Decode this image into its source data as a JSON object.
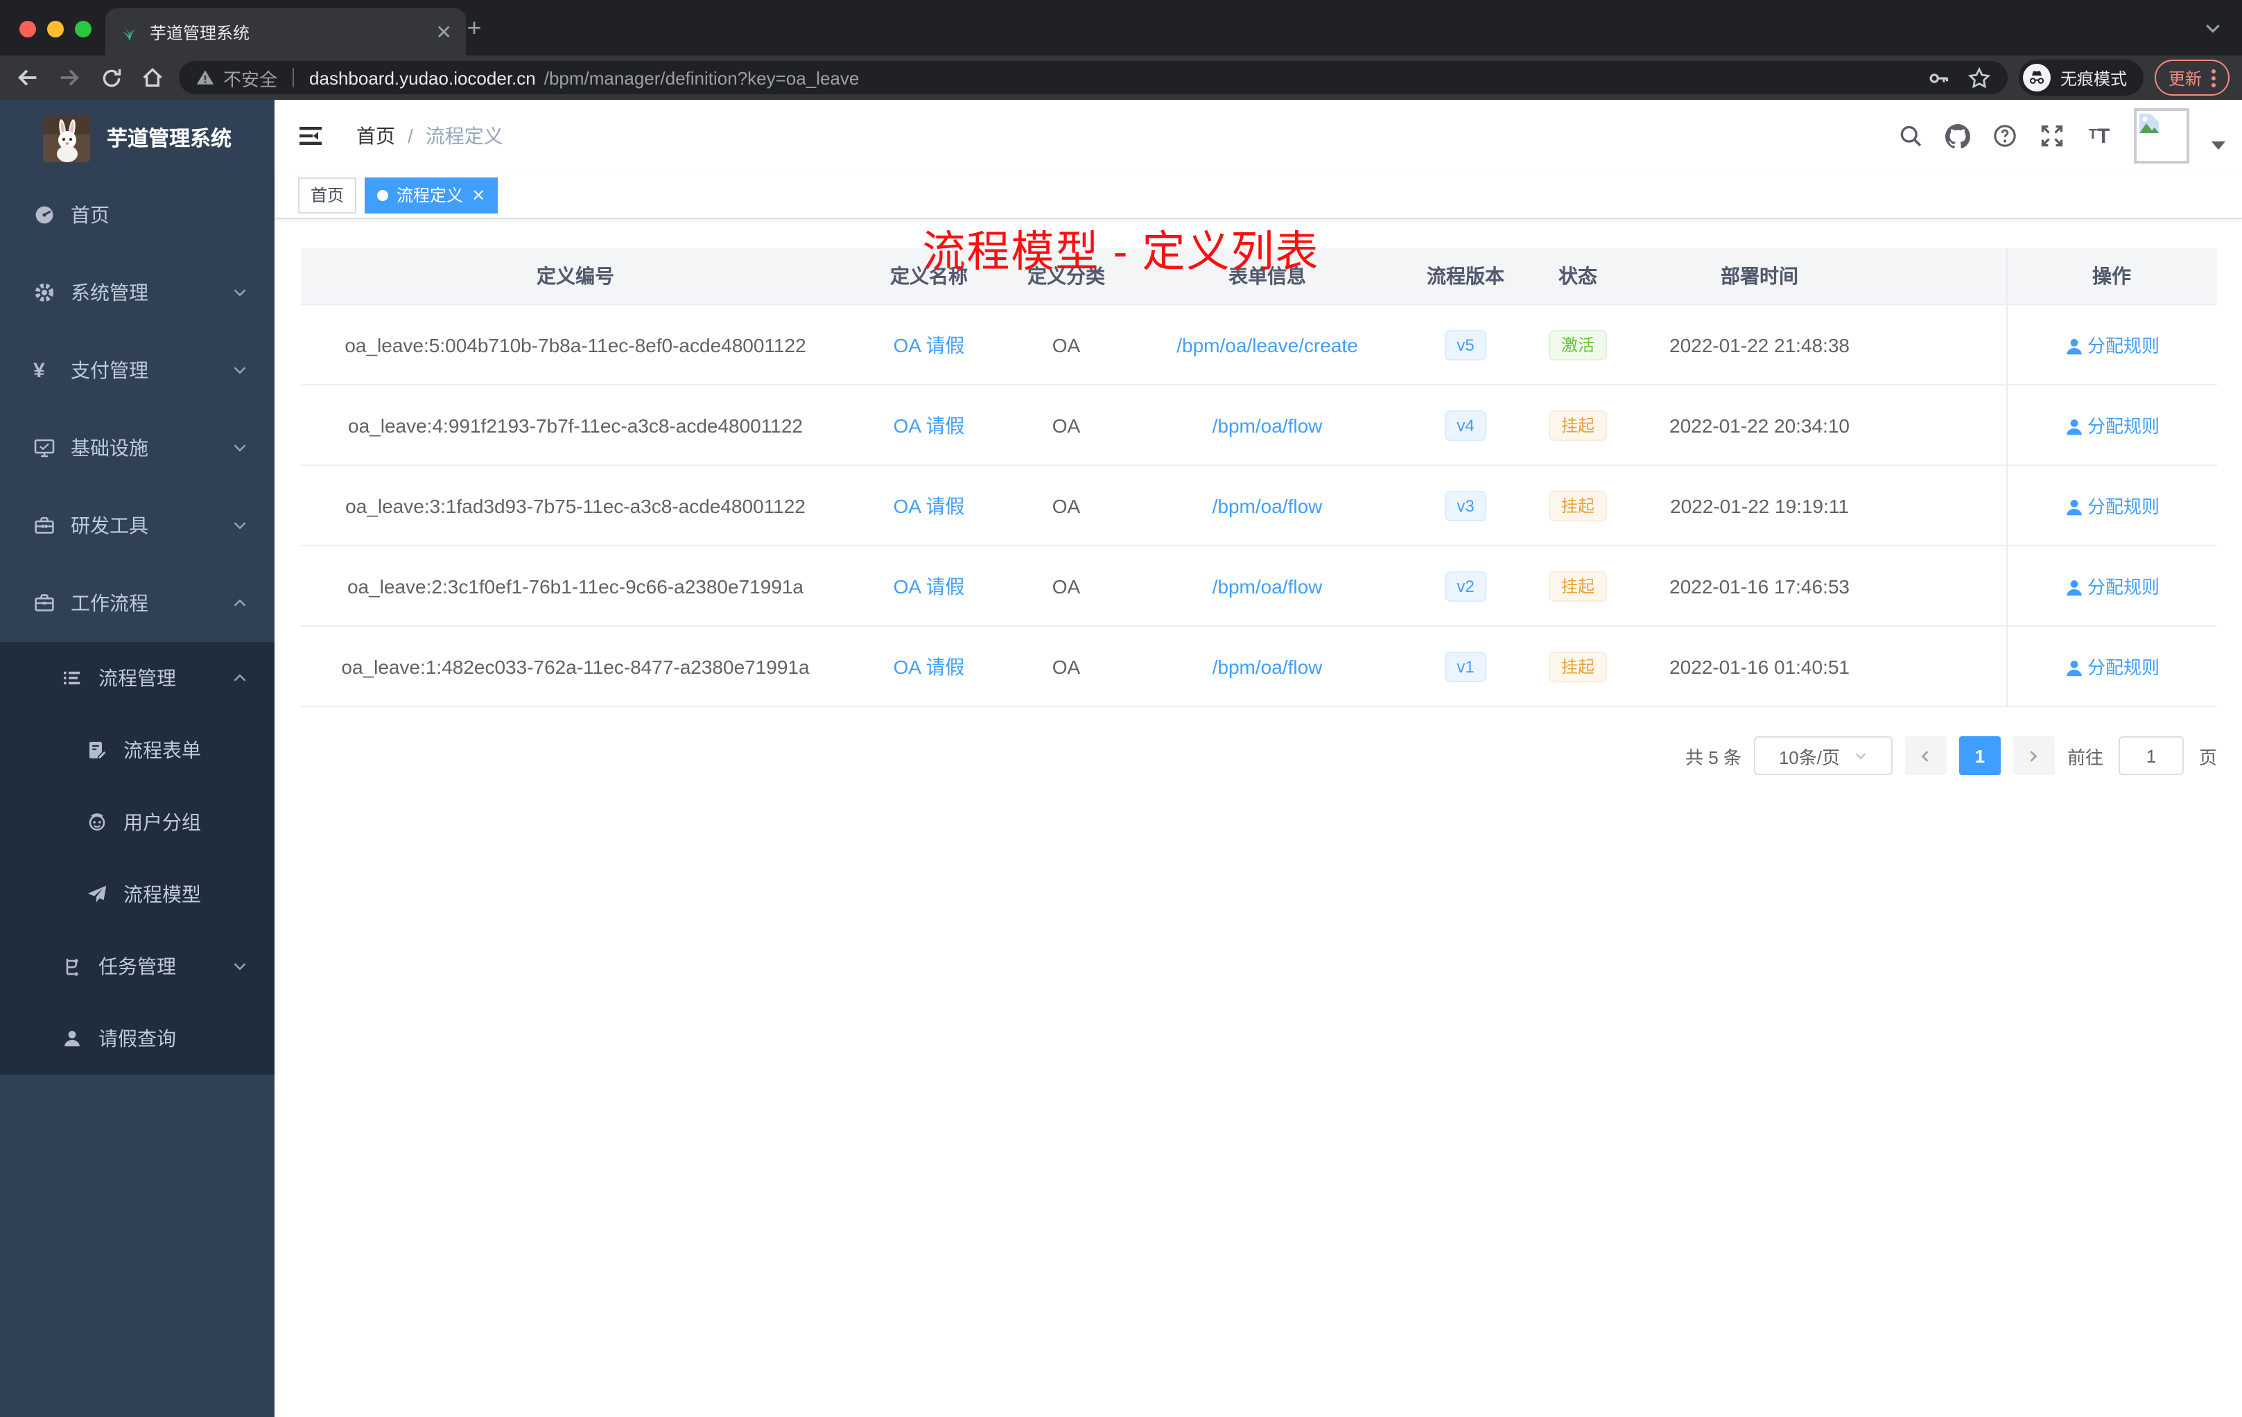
{
  "browser": {
    "tab": {
      "title": "芋道管理系统",
      "favicon": "plant-icon"
    },
    "new_tab_label": "+",
    "security_label": "不安全",
    "url": {
      "host": "dashboard.yudao.iocoder.cn",
      "path": "/bpm/manager/definition?key=oa_leave"
    },
    "incognito_label": "无痕模式",
    "update_label": "更新",
    "traffic_colors": {
      "close": "#ff5f57",
      "minimize": "#febc2e",
      "zoom": "#28c840"
    }
  },
  "sidebar": {
    "app_title": "芋道管理系统",
    "menu": [
      {
        "label": "首页",
        "icon": "dashboard-icon"
      },
      {
        "label": "系统管理",
        "icon": "gear-icon",
        "chevron": "down"
      },
      {
        "label": "支付管理",
        "icon": "yen-icon",
        "chevron": "down"
      },
      {
        "label": "基础设施",
        "icon": "monitor-icon",
        "chevron": "down"
      },
      {
        "label": "研发工具",
        "icon": "toolbox-icon",
        "chevron": "down"
      },
      {
        "label": "工作流程",
        "icon": "briefcase-icon",
        "chevron": "up"
      }
    ],
    "submenu": [
      {
        "label": "流程管理",
        "icon": "list-icon",
        "chevron": "up",
        "indent": 1
      },
      {
        "label": "流程表单",
        "icon": "form-icon",
        "indent": 2
      },
      {
        "label": "用户分组",
        "icon": "robot-icon",
        "indent": 2
      },
      {
        "label": "流程模型",
        "icon": "paper-plane-icon",
        "indent": 2
      },
      {
        "label": "任务管理",
        "icon": "tree-icon",
        "chevron": "down",
        "indent": 1
      },
      {
        "label": "请假查询",
        "icon": "user-icon",
        "indent": 1
      }
    ]
  },
  "header": {
    "breadcrumb": [
      "首页",
      "流程定义"
    ],
    "annotation_title": "流程模型 - 定义列表"
  },
  "tags": [
    {
      "label": "首页",
      "active": false
    },
    {
      "label": "流程定义",
      "active": true
    }
  ],
  "table": {
    "columns": [
      "定义编号",
      "定义名称",
      "定义分类",
      "表单信息",
      "流程版本",
      "状态",
      "部署时间",
      "操作"
    ],
    "rows": [
      {
        "id": "oa_leave:5:004b710b-7b8a-11ec-8ef0-acde48001122",
        "name": "OA 请假",
        "category": "OA",
        "form": "/bpm/oa/leave/create",
        "version": "v5",
        "status": "激活",
        "status_type": "success",
        "deploy_time": "2022-01-22 21:48:38",
        "action": "分配规则"
      },
      {
        "id": "oa_leave:4:991f2193-7b7f-11ec-a3c8-acde48001122",
        "name": "OA 请假",
        "category": "OA",
        "form": "/bpm/oa/flow",
        "version": "v4",
        "status": "挂起",
        "status_type": "warning",
        "deploy_time": "2022-01-22 20:34:10",
        "action": "分配规则"
      },
      {
        "id": "oa_leave:3:1fad3d93-7b75-11ec-a3c8-acde48001122",
        "name": "OA 请假",
        "category": "OA",
        "form": "/bpm/oa/flow",
        "version": "v3",
        "status": "挂起",
        "status_type": "warning",
        "deploy_time": "2022-01-22 19:19:11",
        "action": "分配规则"
      },
      {
        "id": "oa_leave:2:3c1f0ef1-76b1-11ec-9c66-a2380e71991a",
        "name": "OA 请假",
        "category": "OA",
        "form": "/bpm/oa/flow",
        "version": "v2",
        "status": "挂起",
        "status_type": "warning",
        "deploy_time": "2022-01-16 17:46:53",
        "action": "分配规则"
      },
      {
        "id": "oa_leave:1:482ec033-762a-11ec-8477-a2380e71991a",
        "name": "OA 请假",
        "category": "OA",
        "form": "/bpm/oa/flow",
        "version": "v1",
        "status": "挂起",
        "status_type": "warning",
        "deploy_time": "2022-01-16 01:40:51",
        "action": "分配规则"
      }
    ]
  },
  "pagination": {
    "total_label": "共 5 条",
    "page_size_label": "10条/页",
    "current_page": "1",
    "goto_label": "前往",
    "goto_value": "1",
    "page_unit_label": "页"
  },
  "colors": {
    "accent": "#409eff",
    "sidebar_bg": "#304156",
    "submenu_bg": "#1f2d3d",
    "success": "#67c23a",
    "warning": "#e6a23c",
    "annotation_red": "#fb0f0f"
  }
}
